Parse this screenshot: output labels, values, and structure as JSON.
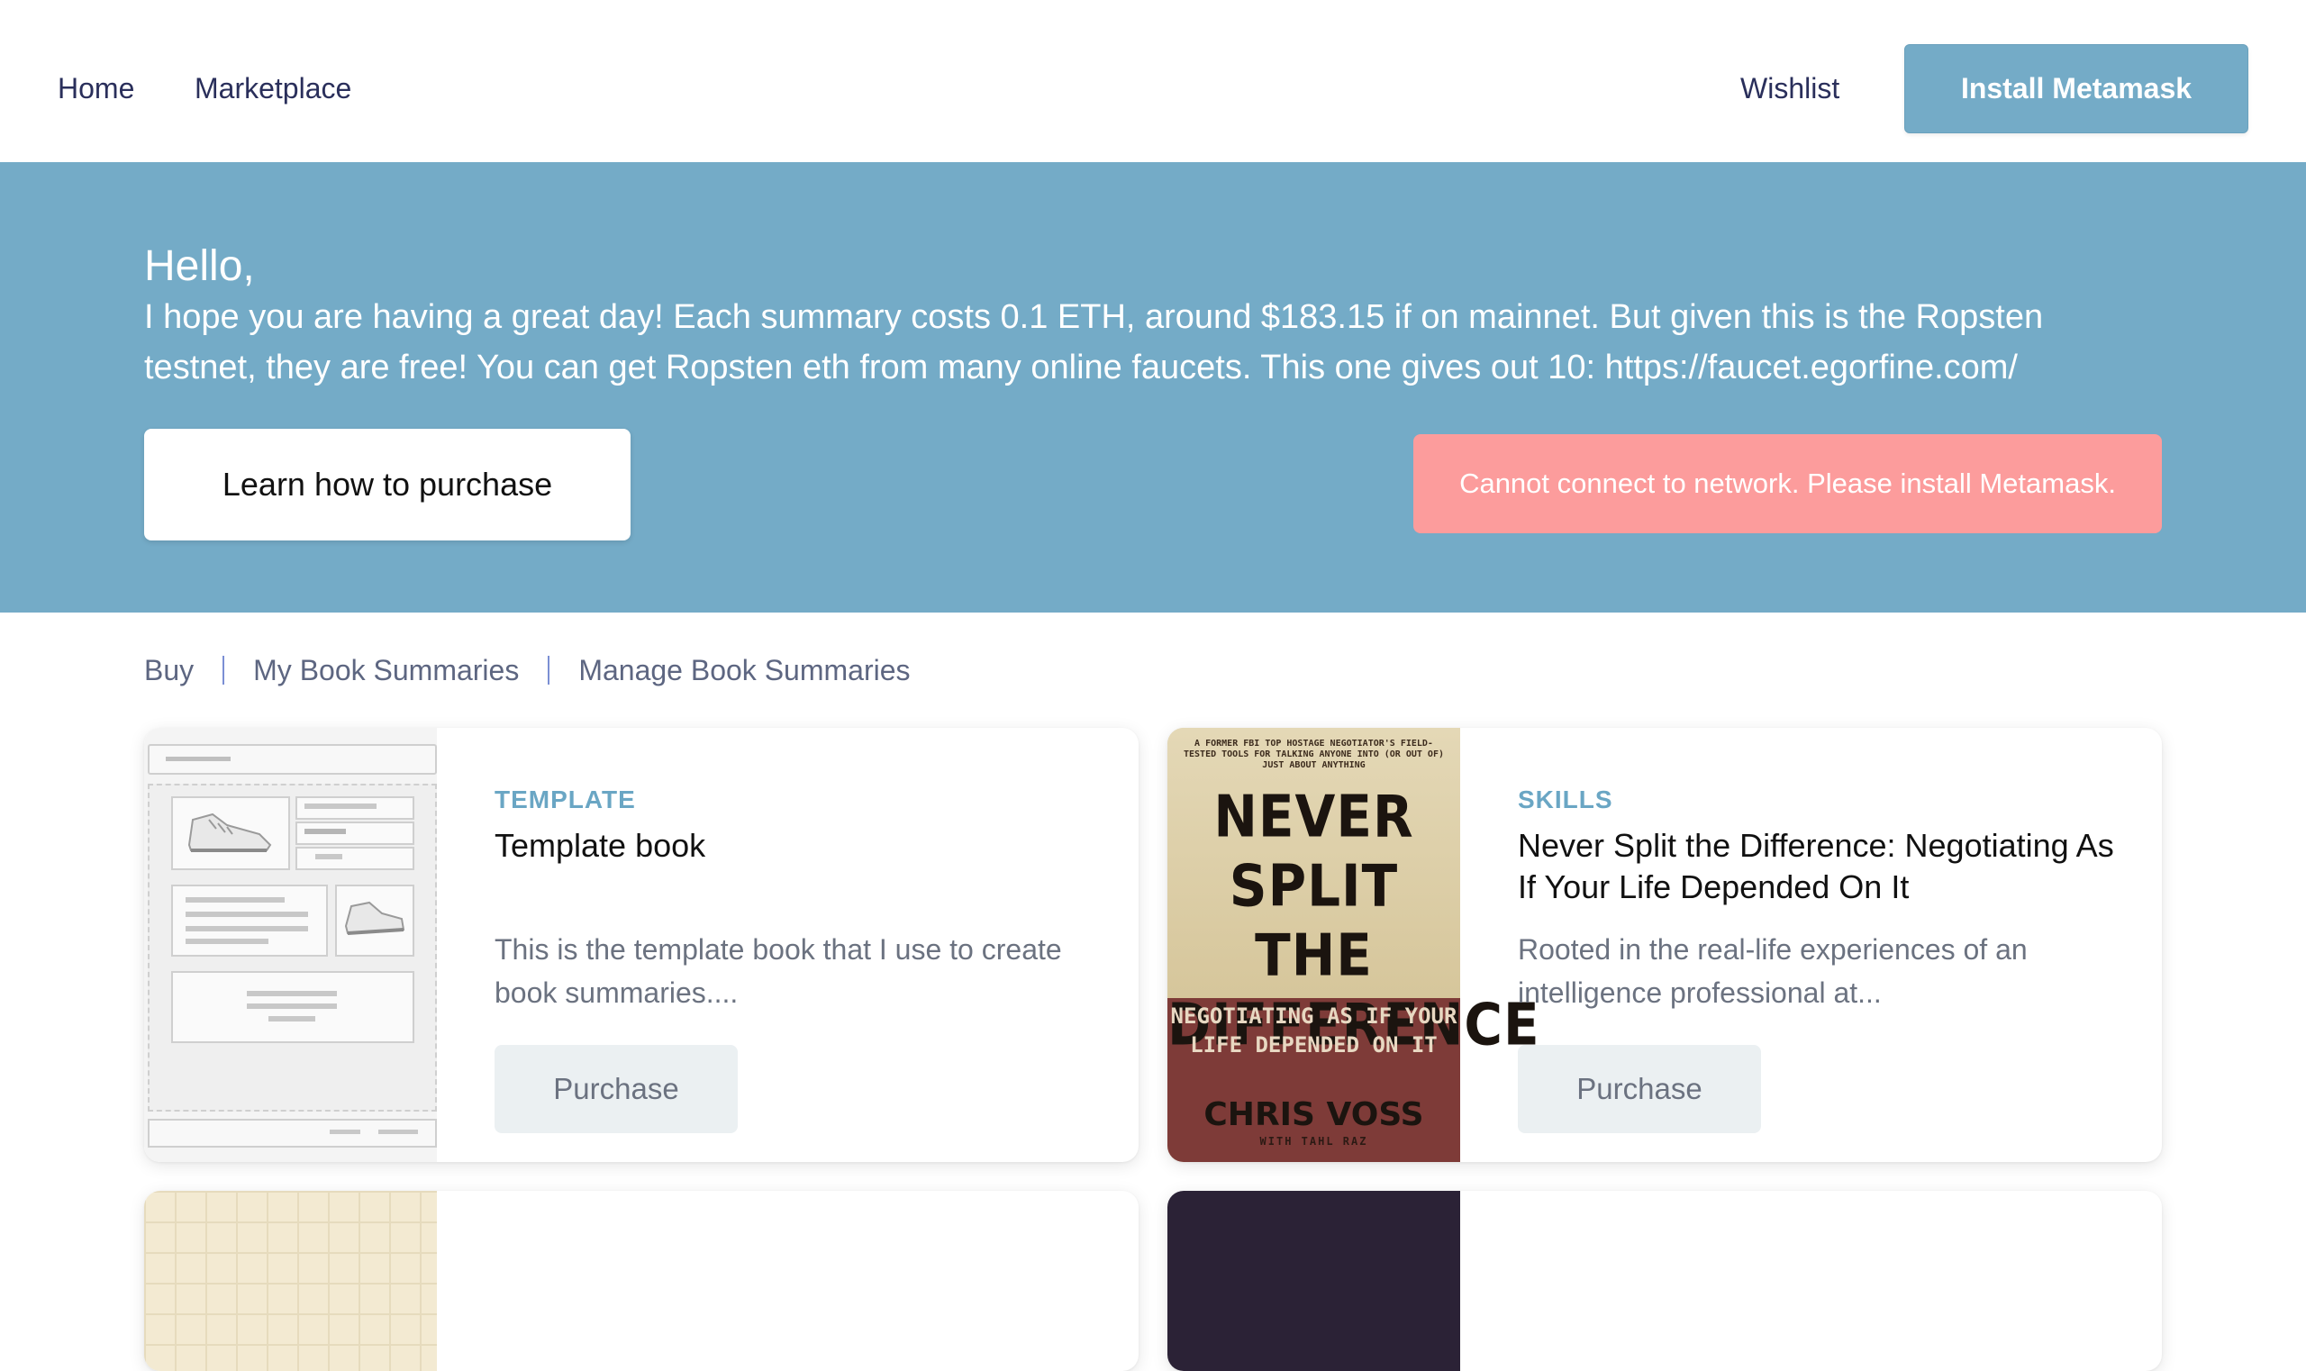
{
  "nav": {
    "home": "Home",
    "marketplace": "Marketplace",
    "wishlist": "Wishlist",
    "install": "Install Metamask"
  },
  "hero": {
    "greeting": "Hello,",
    "message": "I hope you are having a great day! Each summary costs 0.1 ETH, around $183.15 if on mainnet. But given this is the Ropsten testnet, they are free! You can get Ropsten eth from many online faucets. This one gives out 10: https://faucet.egorfine.com/",
    "learn_button": "Learn how to purchase",
    "alert": "Cannot connect to network. Please install Metamask."
  },
  "tabs": [
    "Buy",
    "My Book Summaries",
    "Manage Book Summaries"
  ],
  "cards": [
    {
      "category": "TEMPLATE",
      "title": "Template book",
      "description": "This is the template book that I use to create book summaries....",
      "button": "Purchase"
    },
    {
      "category": "SKILLS",
      "title": "Never Split the Difference: Negotiating As If Your Life Depended On It",
      "description": "Rooted in the real-life experiences of an intelligence professional at...",
      "button": "Purchase",
      "cover": {
        "tagline": "A FORMER FBI TOP HOSTAGE NEGOTIATOR'S FIELD-TESTED TOOLS FOR TALKING ANYONE INTO (OR OUT OF) JUST ABOUT ANYTHING",
        "title": "NEVER SPLIT THE DIFFERENCE",
        "subtitle": "NEGOTIATING AS IF YOUR LIFE DEPENDED ON IT",
        "author": "CHRIS VOSS",
        "coauthor": "WITH TAHL RAZ"
      }
    }
  ],
  "colors": {
    "accent": "#74abc7",
    "alert": "#fc9c9c",
    "category": "#6aa6c4"
  }
}
